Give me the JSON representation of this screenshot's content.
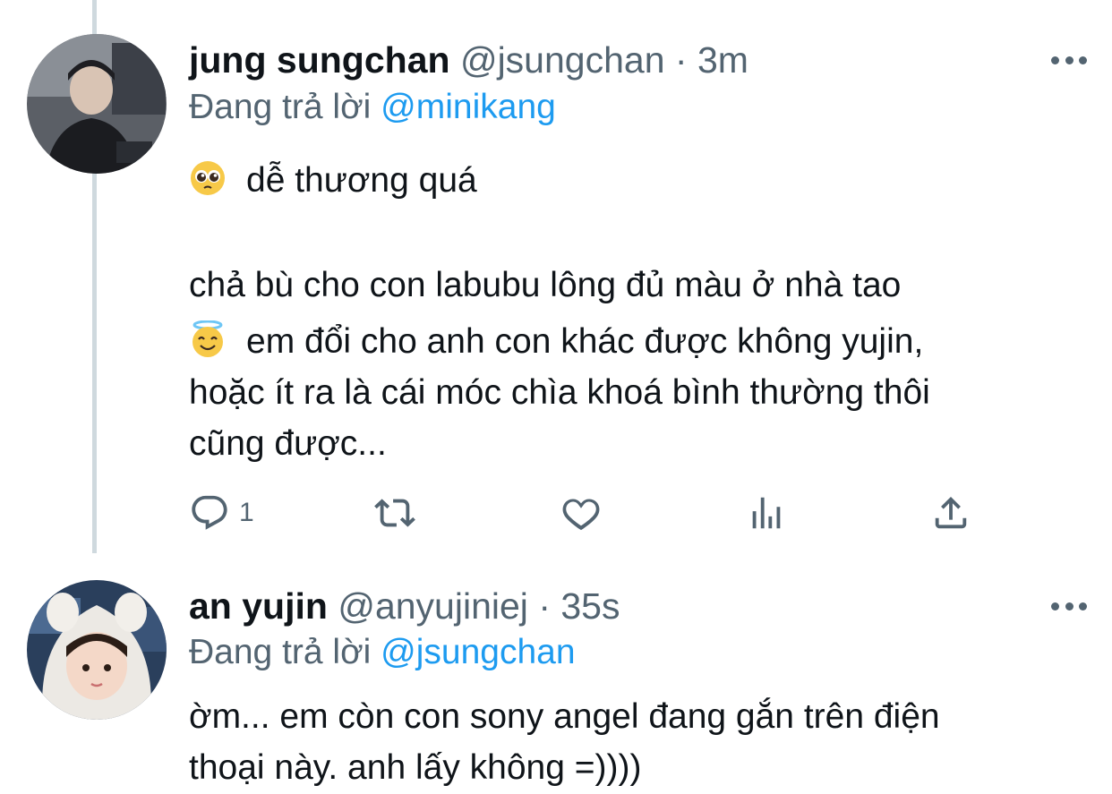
{
  "tweets": [
    {
      "author_name": "jung sungchan",
      "handle": "@jsungchan",
      "separator": "·",
      "time": "3m",
      "reply_prefix": "Đang trả lời",
      "reply_to": "@minikang",
      "lines": [
        "dễ thương quá",
        "",
        "chả bù cho con labubu lông đủ màu ở nhà tao",
        "em đổi cho anh con khác được không yujin,",
        "hoặc ít ra là cái móc chìa khoá bình thường thôi",
        "cũng được..."
      ],
      "emojis": [
        "pleading-face-emoji",
        "smiling-face-with-halo-emoji"
      ],
      "reply_count": "1",
      "avatar": "avatar"
    },
    {
      "author_name": "an yujin",
      "handle": "@anyujiniej",
      "separator": "·",
      "time": "35s",
      "reply_prefix": "Đang trả lời",
      "reply_to": "@jsungchan",
      "lines": [
        "ờm... em còn con sony angel đang gắn trên điện",
        "thoại này. anh lấy không =))))"
      ],
      "avatar": "avatar"
    }
  ],
  "icons": {
    "more": "more-dots-icon",
    "reply": "reply-bubble-icon",
    "retweet": "retweet-icon",
    "like": "heart-icon",
    "analytics": "analytics-bars-icon",
    "share": "share-upload-icon"
  },
  "colors": {
    "accent": "#1d9bf0",
    "muted": "#536471",
    "text": "#0f1419",
    "thread_line": "#cfd9de"
  }
}
